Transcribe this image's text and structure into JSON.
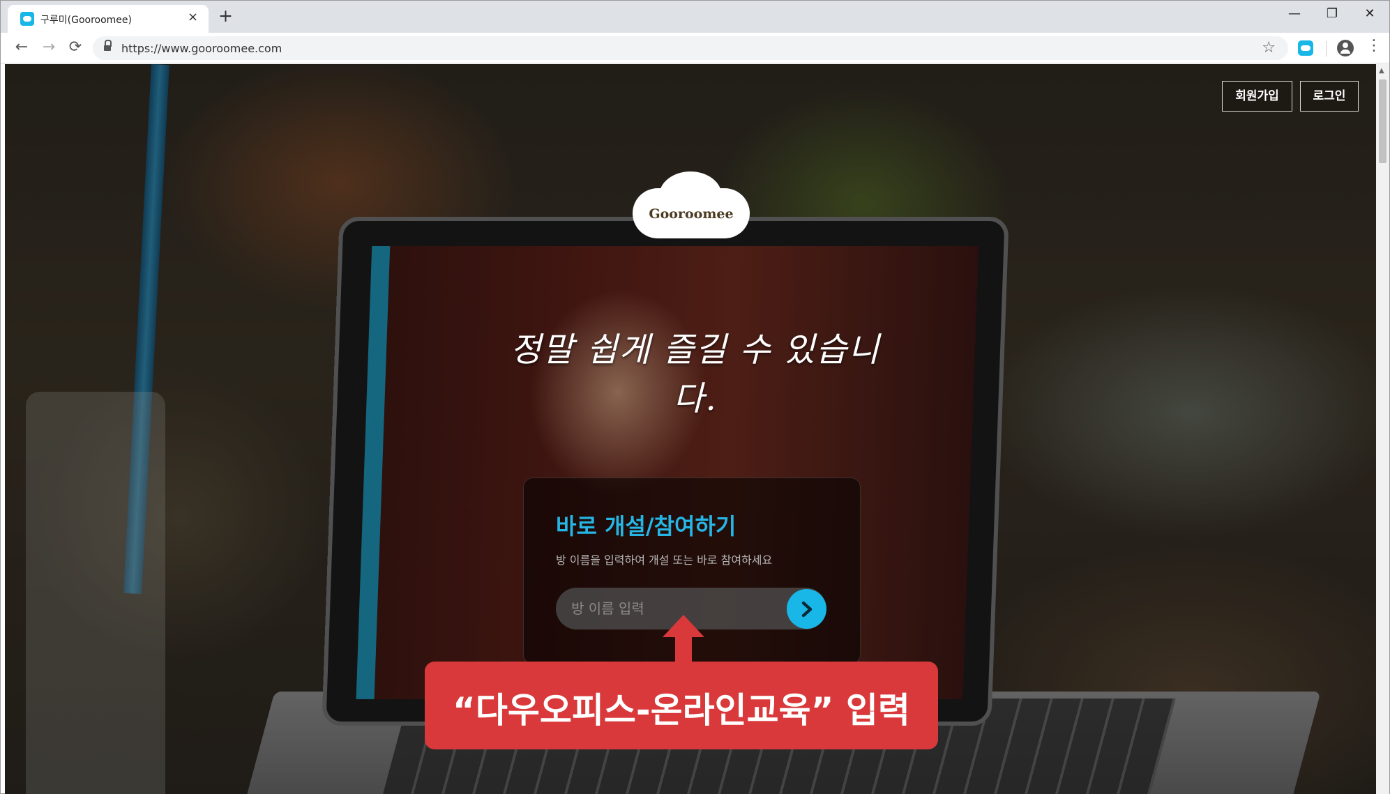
{
  "browser": {
    "tab_title": "구루미(Gooroomee)",
    "tab_close": "×",
    "new_tab": "+",
    "url": "https://www.gooroomee.com",
    "star": "☆",
    "menu": "⋮",
    "back": "←",
    "forward": "→",
    "reload": "⟳",
    "window_controls": {
      "minimize": "—",
      "restore": "❐",
      "close": "✕"
    },
    "accent_color": "#19b6e8"
  },
  "header": {
    "signup_label": "회원가입",
    "login_label": "로그인"
  },
  "hero": {
    "logo_text": "Gooroomee",
    "headline": "정말 쉽게 즐길 수 있습니다."
  },
  "quick_join": {
    "title": "바로 개설/참여하기",
    "description": "방 이름을 입력하여 개설 또는 바로 참여하세요",
    "input_placeholder": "방 이름 입력",
    "input_value": "",
    "go_icon": "chevron-right-icon",
    "title_color": "#25b6e6"
  },
  "annotation": {
    "callout_text": "“다우오피스-온라인교육” 입력",
    "color": "#d9393a"
  }
}
